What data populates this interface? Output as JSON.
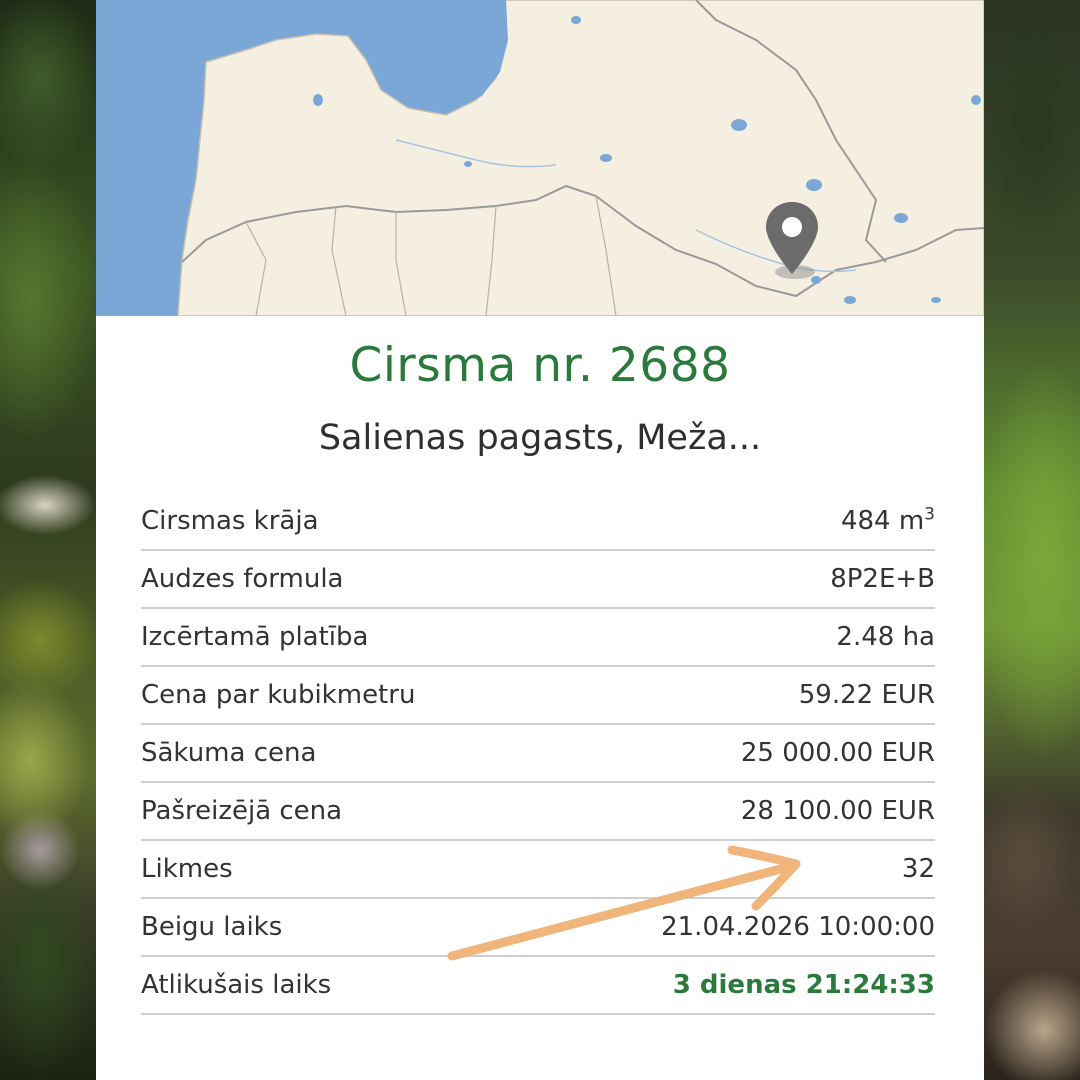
{
  "page": {
    "title": "Cirsma nr. 2688",
    "subtitle": "Salienas pagasts, Meža..."
  },
  "map": {
    "marker_icon": "map-pin-icon",
    "colors": {
      "water": "#7ba7d7",
      "land": "#f5efe1",
      "border": "#9a9a9a",
      "marker": "#6b6b6b"
    }
  },
  "details": [
    {
      "label": "Cirsmas krāja",
      "value": "484 m",
      "unit_sup": "3"
    },
    {
      "label": "Audzes formula",
      "value": "8P2E+B"
    },
    {
      "label": "Izcērtamā platība",
      "value": "2.48 ha"
    },
    {
      "label": "Cena par kubikmetru",
      "value": "59.22 EUR"
    },
    {
      "label": "Sākuma cena",
      "value": "25 000.00 EUR"
    },
    {
      "label": "Pašreizējā cena",
      "value": "28 100.00 EUR"
    },
    {
      "label": "Likmes",
      "value": "32"
    },
    {
      "label": "Beigu laiks",
      "value": "21.04.2026 10:00:00"
    },
    {
      "label": "Atlikušais laiks",
      "value": "3 dienas 21:24:33",
      "highlight": true
    }
  ],
  "colors": {
    "accent_green": "#2a7a3c",
    "arrow": "#f0b57a",
    "text": "#333333",
    "divider": "#cfcfcf"
  },
  "annotation": {
    "icon": "arrow-annotation-icon"
  }
}
